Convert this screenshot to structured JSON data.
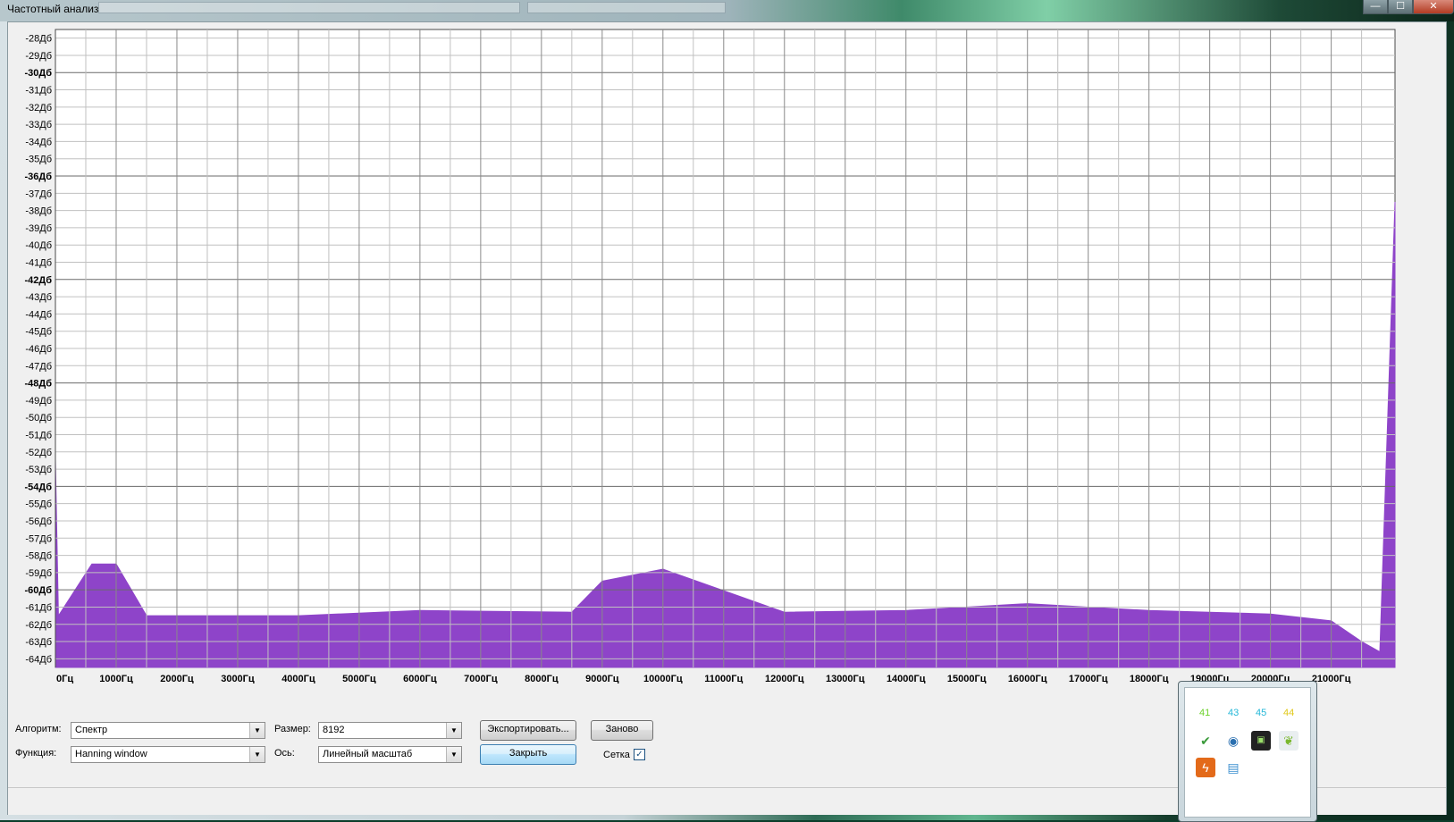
{
  "window": {
    "title": "Частотный анализ",
    "buttons": {
      "minimize": "—",
      "maximize": "☐",
      "close": "✕"
    }
  },
  "chart_data": {
    "type": "area",
    "title": "",
    "xlabel": "",
    "ylabel": "",
    "xlim": [
      0,
      22050
    ],
    "ylim": [
      -64.5,
      -27.5
    ],
    "grid": true,
    "y_ticks": [
      "-28Дб",
      "-29Дб",
      "-30Дб",
      "-31Дб",
      "-32Дб",
      "-33Дб",
      "-34Дб",
      "-35Дб",
      "-36Дб",
      "-37Дб",
      "-38Дб",
      "-39Дб",
      "-40Дб",
      "-41Дб",
      "-42Дб",
      "-43Дб",
      "-44Дб",
      "-45Дб",
      "-46Дб",
      "-47Дб",
      "-48Дб",
      "-49Дб",
      "-50Дб",
      "-51Дб",
      "-52Дб",
      "-53Дб",
      "-54Дб",
      "-55Дб",
      "-56Дб",
      "-57Дб",
      "-58Дб",
      "-59Дб",
      "-60Дб",
      "-61Дб",
      "-62Дб",
      "-63Дб",
      "-64Дб"
    ],
    "y_ticks_bold": [
      "-30Дб",
      "-36Дб",
      "-42Дб",
      "-48Дб",
      "-54Дб",
      "-60Дб"
    ],
    "x_ticks": [
      "0Гц",
      "1000Гц",
      "2000Гц",
      "3000Гц",
      "4000Гц",
      "5000Гц",
      "6000Гц",
      "7000Гц",
      "8000Гц",
      "9000Гц",
      "10000Гц",
      "11000Гц",
      "12000Гц",
      "13000Гц",
      "14000Гц",
      "15000Гц",
      "16000Гц",
      "17000Гц",
      "18000Гц",
      "19000Гц",
      "20000Гц",
      "21000Гц"
    ],
    "series": [
      {
        "color": "#8e44c9",
        "x": [
          0,
          50,
          600,
          1000,
          1500,
          2000,
          4000,
          6000,
          8500,
          9000,
          10000,
          12000,
          14000,
          16000,
          18000,
          19000,
          20000,
          21000,
          21500,
          21800,
          22050
        ],
        "values": [
          -52.5,
          -61.5,
          -58.5,
          -58.5,
          -61.5,
          -61.5,
          -61.5,
          -61.2,
          -61.3,
          -59.5,
          -58.8,
          -61.3,
          -61.2,
          -60.8,
          -61.2,
          -61.3,
          -61.4,
          -61.8,
          -63.0,
          -63.6,
          -37.5
        ]
      }
    ]
  },
  "controls": {
    "algorithm_label": "Алгоритм:",
    "algorithm_value": "Спектр",
    "size_label": "Размер:",
    "size_value": "8192",
    "function_label": "Функция:",
    "function_value": "Hanning window",
    "axis_label": "Ось:",
    "axis_value": "Линейный масштаб",
    "export_button": "Экспортировать...",
    "replot_button": "Заново",
    "close_button": "Закрыть",
    "grid_label": "Сетка",
    "grid_checked": true
  },
  "tray": {
    "numbers": [
      "41",
      "43",
      "45",
      "44"
    ],
    "icons": [
      "usb-safe-remove-icon",
      "network-icon",
      "gpu-monitor-icon",
      "leaf-app-icon",
      "flash-app-icon",
      "media-app-icon"
    ]
  }
}
